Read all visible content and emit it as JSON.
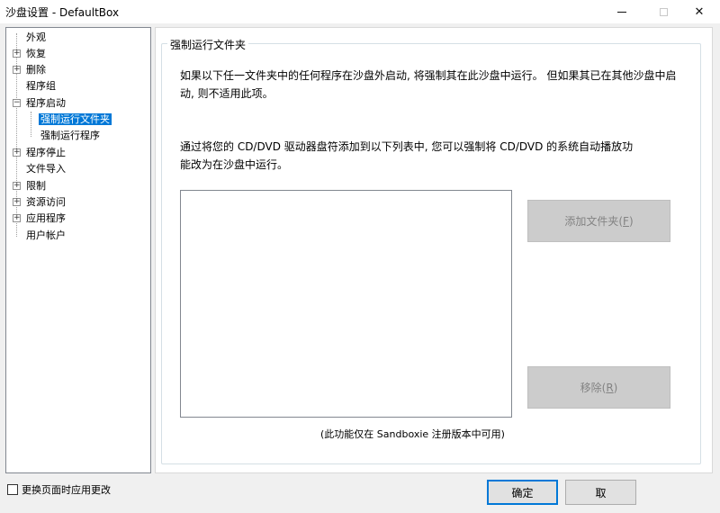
{
  "window": {
    "title": "沙盘设置 - DefaultBox",
    "min_icon": "minimize-icon",
    "max_icon": "maximize-icon",
    "close_icon": "close-icon",
    "close_glyph": "✕"
  },
  "tree": {
    "items": [
      {
        "label": "外观",
        "expander": ""
      },
      {
        "label": "恢复",
        "expander": "+"
      },
      {
        "label": "删除",
        "expander": "+"
      },
      {
        "label": "程序组",
        "expander": ""
      },
      {
        "label": "程序启动",
        "expander": "−"
      },
      {
        "label": "强制运行文件夹",
        "expander": ""
      },
      {
        "label": "强制运行程序",
        "expander": ""
      },
      {
        "label": "程序停止",
        "expander": "+"
      },
      {
        "label": "文件导入",
        "expander": ""
      },
      {
        "label": "限制",
        "expander": "+"
      },
      {
        "label": "资源访问",
        "expander": "+"
      },
      {
        "label": "应用程序",
        "expander": "+"
      },
      {
        "label": "用户帐户",
        "expander": ""
      }
    ],
    "selected": "强制运行文件夹"
  },
  "panel": {
    "group_title": "强制运行文件夹",
    "desc1_line1": "如果以下任一文件夹中的任何程序在沙盘外启动, 将强制其在此沙盘中运行。 但如果其已在其他沙盘中启",
    "desc1_line2": "动, 则不适用此项。",
    "desc2_line1": "通过将您的 CD/DVD 驱动器盘符添加到以下列表中, 您可以强制将 CD/DVD 的系统自动播放功",
    "desc2_line2": "能改为在沙盘中运行。",
    "add_button": {
      "text": "添加文件夹(",
      "key": "F",
      "suffix": ")"
    },
    "remove_button": {
      "text": "移除(",
      "key": "R",
      "suffix": ")"
    },
    "note": "(此功能仅在 Sandboxie 注册版本中可用)"
  },
  "footer": {
    "checkbox_label": "更换页面时应用更改",
    "ok_label": "确定",
    "cancel_label": "取"
  }
}
